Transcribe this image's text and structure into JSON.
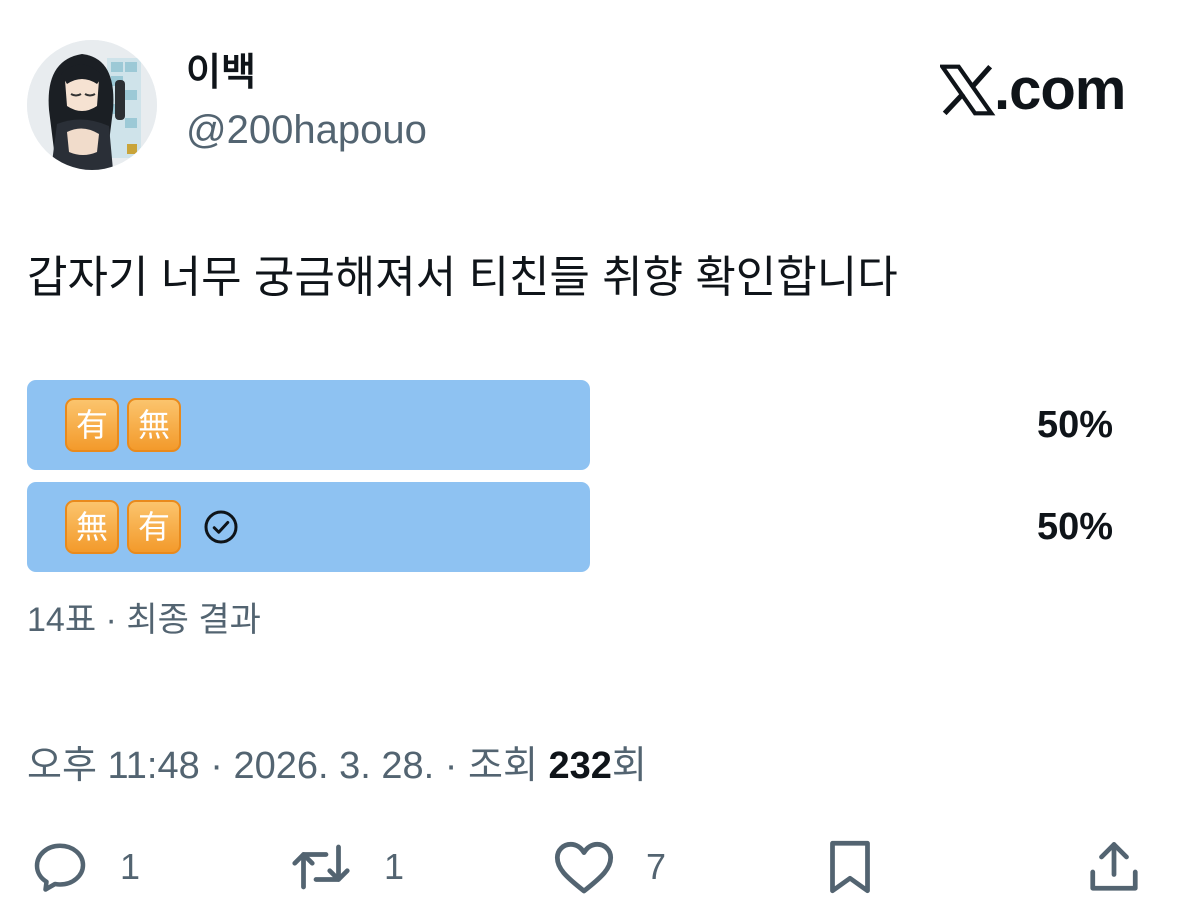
{
  "author": {
    "display_name": "이백",
    "handle": "@200hapouo",
    "avatar_icon": "anime-character-avatar"
  },
  "brand": {
    "icon": "x-logo-icon",
    "text": ".com"
  },
  "tweet": {
    "text": "갑자기 너무 궁금해져서 티친들 취향 확인합니다"
  },
  "poll": {
    "options": [
      {
        "emoji": [
          "有",
          "無"
        ],
        "percent_label": "50%",
        "percent": 50,
        "chosen": false
      },
      {
        "emoji": [
          "無",
          "有"
        ],
        "percent_label": "50%",
        "percent": 50,
        "chosen": true
      }
    ],
    "meta": "14표 · 최종 결과",
    "bar_color": "#8ec2f2"
  },
  "timestamp": {
    "prefix": "오후 11:48 · 2026. 3. 28. · 조회 ",
    "views": "232",
    "suffix": "회"
  },
  "actions": [
    {
      "icon": "reply-icon",
      "count": "1"
    },
    {
      "icon": "retweet-icon",
      "count": "1"
    },
    {
      "icon": "like-icon",
      "count": "7"
    },
    {
      "icon": "bookmark-icon",
      "count": ""
    },
    {
      "icon": "share-icon",
      "count": ""
    }
  ]
}
